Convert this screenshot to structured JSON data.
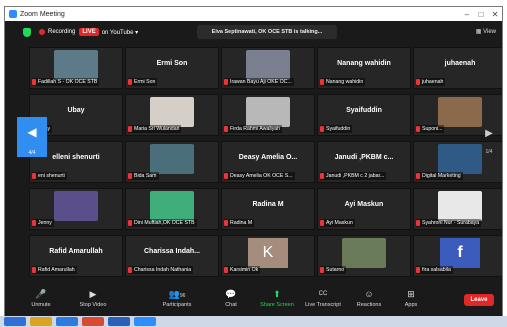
{
  "window": {
    "title": "Zoom Meeting",
    "controls": [
      "–",
      "□",
      "✕"
    ]
  },
  "topbar": {
    "recording_label": "Recording",
    "live_label": "LIVE",
    "live_target": "on YouTube ▾",
    "talking": "Elva Septinawati, OK OCE STB is talking...",
    "view_label": "View"
  },
  "tiles": [
    {
      "name": "",
      "label": "Fadillah S - OK OCE STB",
      "media": "photo",
      "color": "#5c7a88"
    },
    {
      "name": "Ermi Son",
      "label": "Ermi Son",
      "media": ""
    },
    {
      "name": "",
      "label": "Irawan Bayu Aji OKE OC...",
      "media": "photo",
      "color": "#7a8090"
    },
    {
      "name": "Nanang wahidin",
      "label": "Nanang wahidin",
      "media": ""
    },
    {
      "name": "juhaenah",
      "label": "juhaenah",
      "media": ""
    },
    {
      "name": "Ubay",
      "label": "Ubay",
      "media": ""
    },
    {
      "name": "",
      "label": "Maria Sri Wulandari",
      "media": "photo",
      "color": "#d6cfc8"
    },
    {
      "name": "",
      "label": "Firda Rahmi Awaliyah",
      "media": "photo",
      "color": "#b8b8b8"
    },
    {
      "name": "Syaifuddin",
      "label": "Syaifuddin",
      "media": ""
    },
    {
      "name": "",
      "label": "Suponi...",
      "media": "photo",
      "color": "#8a6a4a"
    },
    {
      "name": "elleni shenurti",
      "label": "eni shenurti",
      "media": ""
    },
    {
      "name": "",
      "label": "Bida Sam",
      "media": "photo",
      "color": "#4a6f7a"
    },
    {
      "name": "Deasy Amelia O...",
      "label": "Deasy Amelia OK OCE S...",
      "media": ""
    },
    {
      "name": "Janudi ,PKBM c...",
      "label": "Janudi ,PKBM c 2 jabar...",
      "media": ""
    },
    {
      "name": "",
      "label": "Digital Marketing",
      "media": "photo",
      "color": "#2f5a86"
    },
    {
      "name": "",
      "label": "Jenny",
      "media": "photo",
      "color": "#5a4f8a"
    },
    {
      "name": "",
      "label": "Dini Muftiah,OK OCE STB",
      "media": "photo",
      "color": "#3fae7a"
    },
    {
      "name": "Radina M",
      "label": "Radina M",
      "media": ""
    },
    {
      "name": "Ayi Maskun",
      "label": "Ayi Maskun",
      "media": ""
    },
    {
      "name": "",
      "label": "Syahroni Nur - Surabaya",
      "media": "photo",
      "color": "#e8e8e8"
    },
    {
      "name": "Rafid Amarullah",
      "label": "Rafid Amarullah",
      "media": ""
    },
    {
      "name": "Charissa Indah...",
      "label": "Charissa Indah Nathania",
      "media": ""
    },
    {
      "name": "",
      "label": "Karsimin Ok",
      "media": "letter",
      "letter": "K"
    },
    {
      "name": "",
      "label": "Sutarno",
      "media": "photo",
      "color": "#6a7b5a"
    },
    {
      "name": "",
      "label": "fira salsabila",
      "media": "letter-f",
      "letter": "f"
    }
  ],
  "pager": {
    "prev_icon": "◀",
    "prev_page": "4/4",
    "next_icon": "▶",
    "next_page": "1/4"
  },
  "toolbar": {
    "items": [
      {
        "label": "Unmute",
        "icon": "🎤"
      },
      {
        "label": "Stop Video",
        "icon": "▶"
      },
      {
        "label": "Participants",
        "icon": "👥",
        "count": "96"
      },
      {
        "label": "Chat",
        "icon": "💬"
      },
      {
        "label": "Share Screen",
        "icon": "⬆"
      },
      {
        "label": "Live Transcript",
        "icon": "CC"
      },
      {
        "label": "Reactions",
        "icon": "☺"
      },
      {
        "label": "Apps",
        "icon": "⊞"
      }
    ],
    "leave_label": "Leave"
  },
  "taskbar": {
    "items": [
      "start",
      "explorer",
      "edge",
      "chrome",
      "word",
      "zoom"
    ]
  },
  "colors": {
    "accent": "#2d8cff",
    "live": "#e02828",
    "share": "#23d959"
  }
}
